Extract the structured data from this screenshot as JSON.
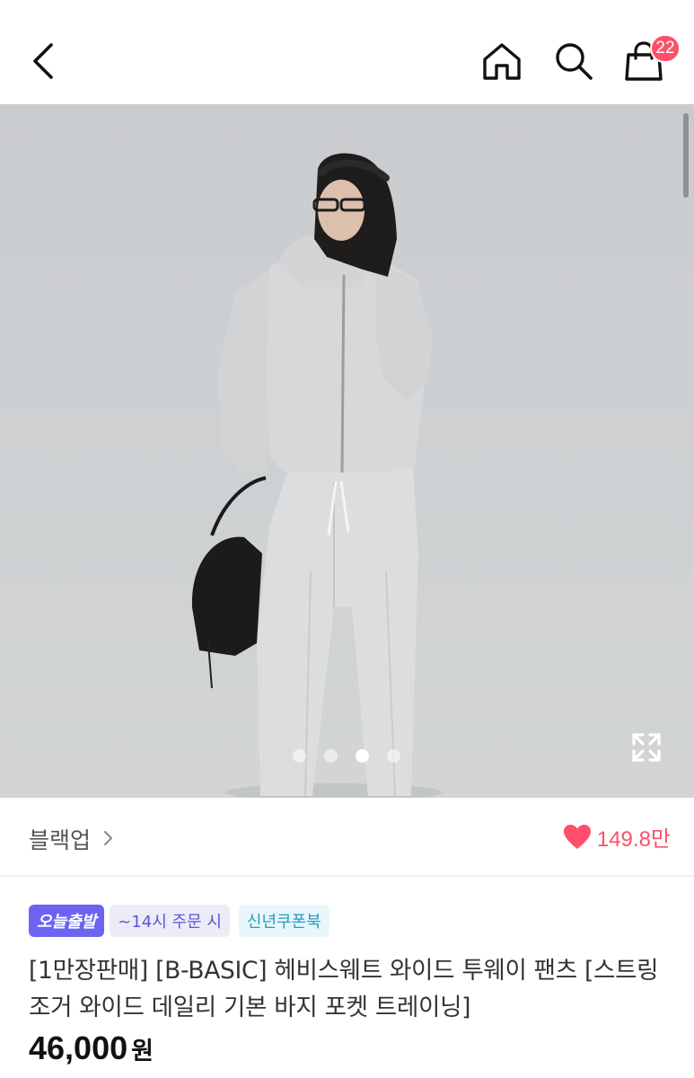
{
  "header": {
    "back_icon": "chevron-left-icon",
    "home_icon": "home-icon",
    "search_icon": "search-icon",
    "cart_icon": "shopping-bag-icon",
    "cart_badge": "22",
    "badge_color": "#ff4f6a"
  },
  "gallery": {
    "total_images": 4,
    "active_index": 2,
    "fullscreen_icon": "expand-icon"
  },
  "brand": {
    "name": "블랙업",
    "chevron": "›",
    "like_icon": "heart-icon",
    "like_count": "149.8만",
    "like_color": "#ff4f6a"
  },
  "tags": {
    "today": "오늘출발",
    "time": "~14시 주문 시",
    "coupon": "신년쿠폰북"
  },
  "product": {
    "title": "[1만장판매] [B-BASIC] 헤비스웨트 와이드 투웨이 팬츠 [스트링 조거 와이드 데일리 기본 바지 포켓 트레이닝]",
    "price": "46,000",
    "price_unit": "원"
  }
}
